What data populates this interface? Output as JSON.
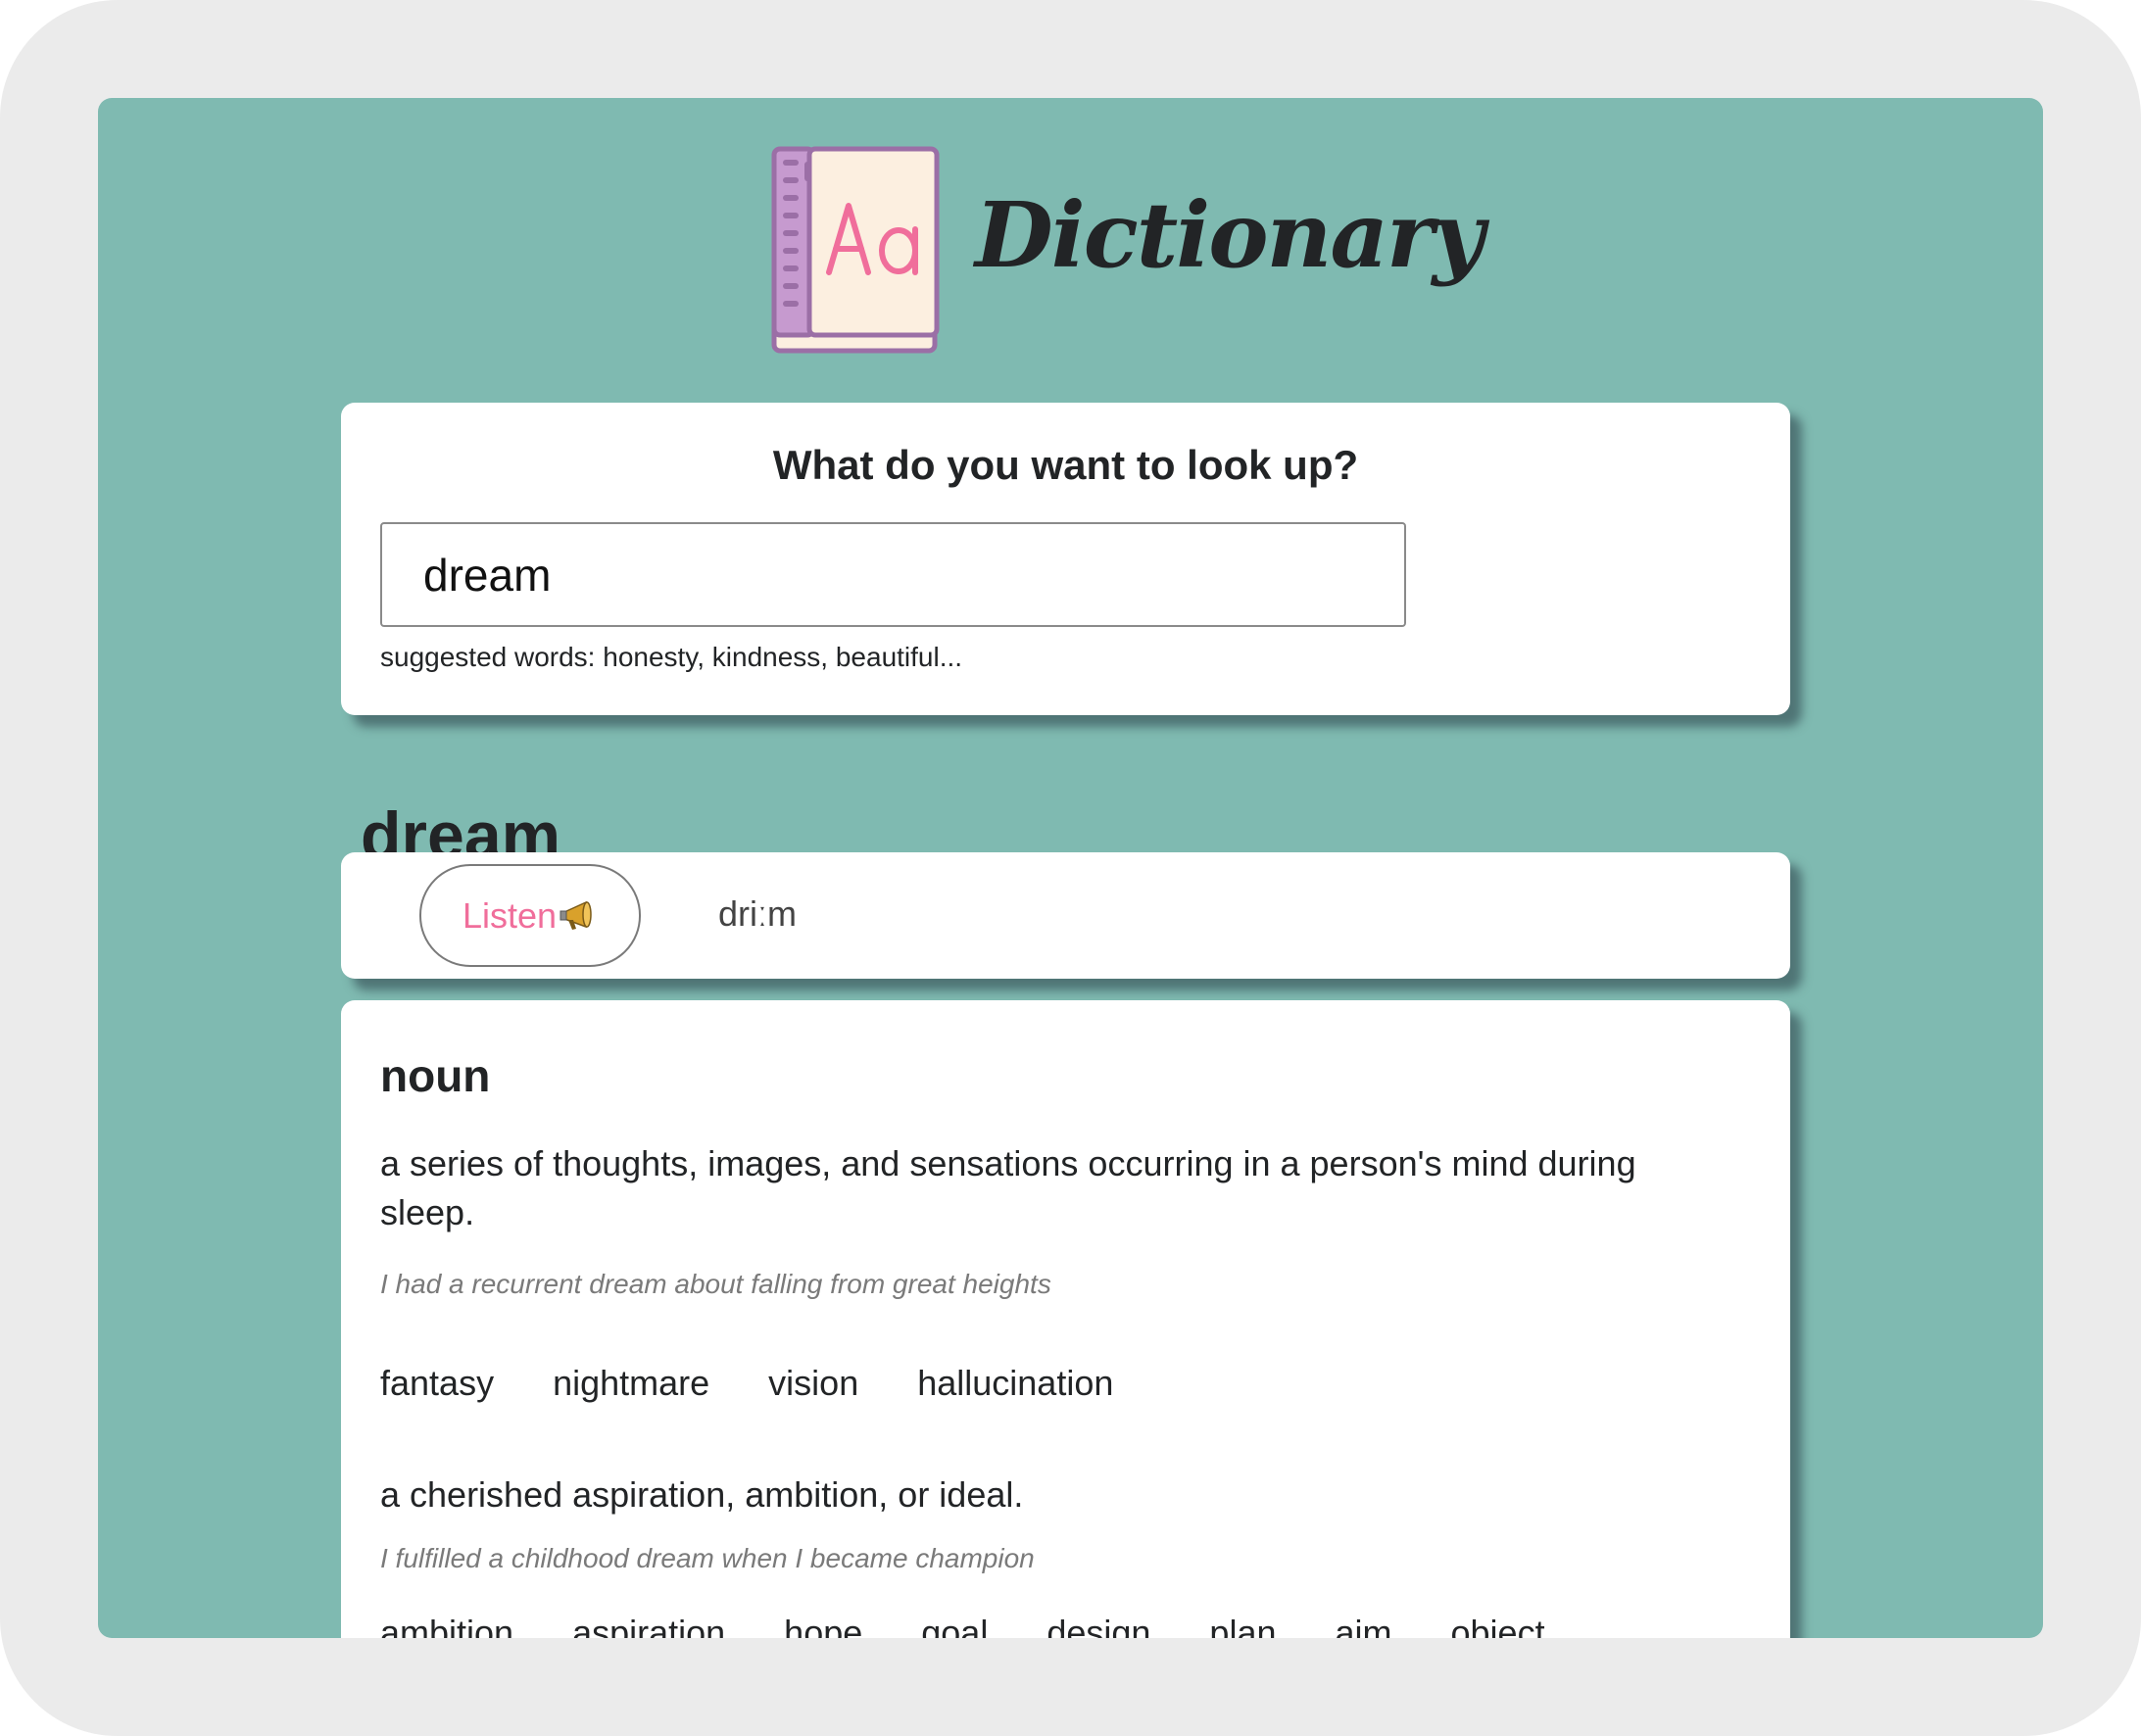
{
  "app": {
    "title": "Dictionary",
    "logo_letters": "Aa"
  },
  "search": {
    "heading": "What do you want to look up?",
    "value": "dream",
    "suggested": "suggested words: honesty, kindness, beautiful..."
  },
  "result": {
    "word": "dream",
    "phonetic": {
      "listen_label": "Listen",
      "listen_icon": "megaphone-icon",
      "text": "driːm"
    },
    "meaning": {
      "part_of_speech": "noun",
      "definitions": [
        {
          "definition": "a series of thoughts, images, and sensations occurring in a person's mind during sleep.",
          "example": "I had a recurrent dream about falling from great heights",
          "synonyms": [
            "fantasy",
            "nightmare",
            "vision",
            "hallucination"
          ]
        },
        {
          "definition": "a cherished aspiration, ambition, or ideal.",
          "example": "I fulfilled a childhood dream when I became champion",
          "synonyms": [
            "ambition",
            "aspiration",
            "hope",
            "goal",
            "design",
            "plan",
            "aim",
            "object"
          ]
        }
      ]
    }
  },
  "colors": {
    "background": "#7fbab1",
    "card": "#ffffff",
    "accent_pink": "#f06e9b",
    "logo_purple": "#9b6fa6",
    "logo_page": "#fcefe0",
    "text_dark": "#222426",
    "frame": "#ebebeb"
  }
}
